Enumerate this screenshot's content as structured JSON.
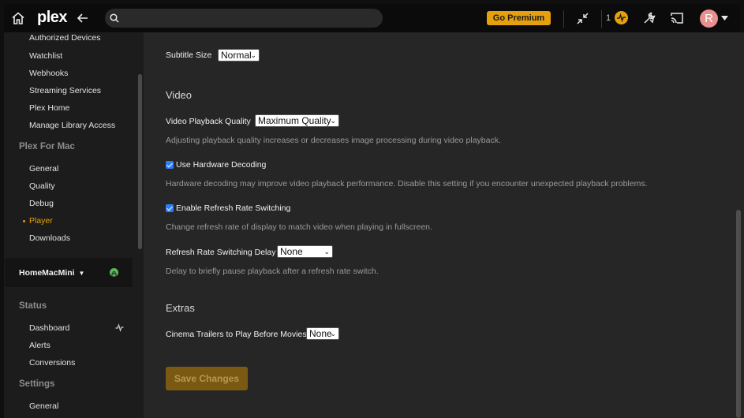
{
  "topbar": {
    "logo_text": "plex",
    "search_placeholder": "",
    "premium_label": "Go Premium",
    "activity_count": "1",
    "avatar_initial": "R",
    "icons": [
      "home-icon",
      "back-arrow-icon",
      "search-icon",
      "minimize-icon",
      "activity-icon",
      "settings-wrench-icon",
      "cast-icon",
      "chevron-down-icon"
    ],
    "accent_color": "#e5a00d"
  },
  "sidebar": {
    "account_items": [
      {
        "label": "Authorized Devices"
      },
      {
        "label": "Watchlist"
      },
      {
        "label": "Webhooks"
      },
      {
        "label": "Streaming Services"
      },
      {
        "label": "Plex Home"
      },
      {
        "label": "Manage Library Access"
      }
    ],
    "app_section_title": "Plex For Mac",
    "app_items": [
      {
        "label": "General"
      },
      {
        "label": "Quality"
      },
      {
        "label": "Debug"
      },
      {
        "label": "Player",
        "active": true
      },
      {
        "label": "Downloads"
      }
    ],
    "server_name": "HomeMacMini",
    "status_section_title": "Status",
    "status_items": [
      {
        "label": "Dashboard"
      },
      {
        "label": "Alerts"
      },
      {
        "label": "Conversions"
      }
    ],
    "settings_section_title": "Settings",
    "settings_items": [
      {
        "label": "General"
      }
    ]
  },
  "main": {
    "subtitle_size_label": "Subtitle Size",
    "subtitle_size_value": "Normal",
    "video_section_title": "Video",
    "playback_quality_label": "Video Playback Quality",
    "playback_quality_value": "Maximum Quality",
    "playback_quality_help": "Adjusting playback quality increases or decreases image processing during video playback.",
    "hw_decoding_label": "Use Hardware Decoding",
    "hw_decoding_checked": true,
    "hw_decoding_help": "Hardware decoding may improve video playback performance. Disable this setting if you encounter unexpected playback problems.",
    "refresh_switch_label": "Enable Refresh Rate Switching",
    "refresh_switch_checked": true,
    "refresh_switch_help": "Change refresh rate of display to match video when playing in fullscreen.",
    "refresh_delay_label": "Refresh Rate Switching Delay",
    "refresh_delay_value": "None",
    "refresh_delay_help": "Delay to briefly pause playback after a refresh rate switch.",
    "extras_section_title": "Extras",
    "cinema_trailers_label": "Cinema Trailers to Play Before Movies",
    "cinema_trailers_value": "None",
    "save_label": "Save Changes"
  }
}
